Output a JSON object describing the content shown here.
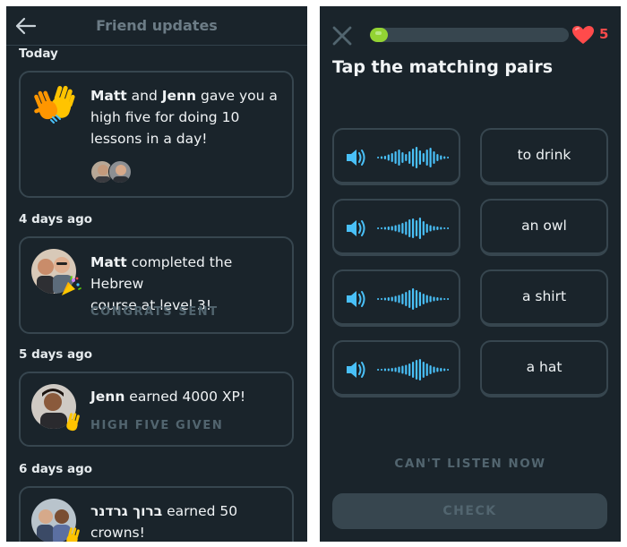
{
  "friend_updates": {
    "title": "Friend updates",
    "sections": [
      {
        "label": "Today",
        "card": {
          "name1": "Matt",
          "conj": " and ",
          "name2": "Jenn",
          "line1_rest": " gave you a",
          "line2": "high five for doing 10",
          "line3": "lessons in a day!",
          "status": ""
        }
      },
      {
        "label": "4 days ago",
        "card": {
          "name1": "Matt",
          "line1_rest": " completed the Hebrew",
          "line2": "course at level 3!",
          "status": "CONGRATS SENT"
        }
      },
      {
        "label": "5 days ago",
        "card": {
          "name1": "Jenn",
          "line1_rest": " earned 4000 XP!",
          "status": "HIGH FIVE GIVEN"
        }
      },
      {
        "label": "6 days ago",
        "card": {
          "name1": "ברוך גרדנר",
          "line1_rest": " earned 50",
          "line2": "crowns!"
        }
      }
    ]
  },
  "lesson": {
    "progress": 0.05,
    "hearts": "5",
    "prompt": "Tap the matching pairs",
    "words": [
      "to drink",
      "an owl",
      "a shirt",
      "a hat"
    ],
    "cant_listen": "CAN'T LISTEN NOW",
    "check": "CHECK",
    "colors": {
      "audio_blue": "#49c0f8",
      "progress_green": "#93d333",
      "heart_red": "#ff4b4b",
      "panel_bg": "#1a242b",
      "border": "#37464f"
    },
    "icons": [
      "close-icon",
      "heart-icon",
      "speaker-icon",
      "waveform-icon"
    ]
  }
}
